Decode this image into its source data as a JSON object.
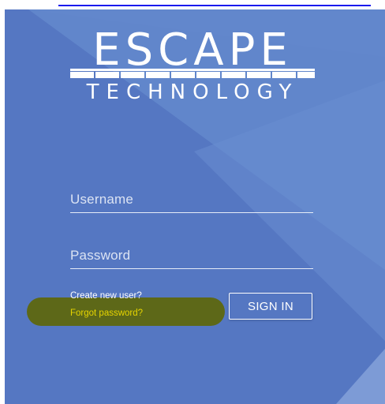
{
  "logo": {
    "title": "ESCAPE",
    "subtitle": "TECHNOLOGY"
  },
  "form": {
    "username_placeholder": "Username",
    "password_placeholder": "Password",
    "username_value": "",
    "password_value": ""
  },
  "links": {
    "create_user": "Create new user?",
    "forgot_password": "Forgot password?"
  },
  "actions": {
    "sign_in": "SIGN IN"
  },
  "colors": {
    "panel": "#5577c2",
    "highlight": "#5f6600",
    "forgot_link": "#e6d400"
  }
}
